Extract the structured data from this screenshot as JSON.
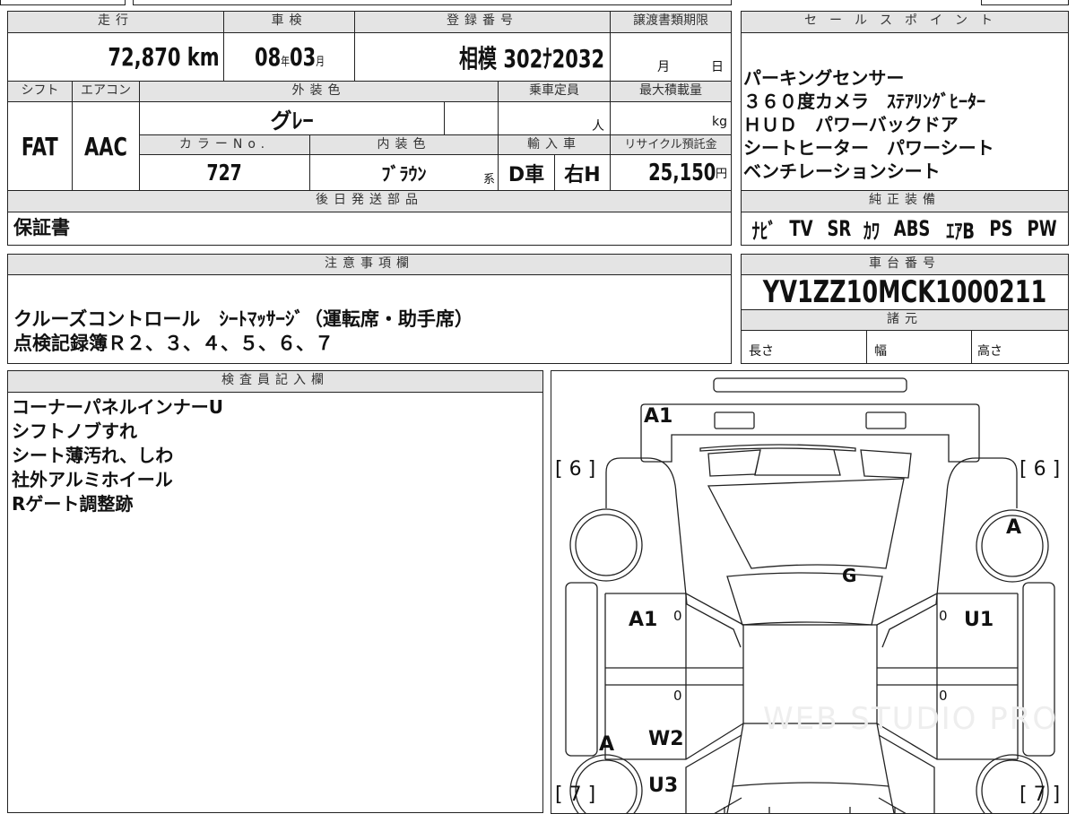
{
  "main": {
    "mileage_header": "走行",
    "mileage": "72,870",
    "mileage_unit": "km",
    "inspection_header": "車検",
    "inspection_year": "08",
    "year_unit": "年",
    "inspection_month": "03",
    "month_unit": "月",
    "registration_header": "登録番号",
    "registration": "相模 302ﾅ2032",
    "transfer_header": "譲渡書類期限",
    "transfer_month": "月",
    "transfer_day": "日",
    "shift_header": "シフト",
    "shift": "FAT",
    "ac_header": "エアコン",
    "ac": "AAC",
    "exterior_header": "外装色",
    "exterior": "グﾚｰ",
    "capacity_header": "乗車定員",
    "capacity_unit": "人",
    "load_header": "最大積載量",
    "load_unit": "kg",
    "color_no_header": "カラーNo.",
    "color_no": "727",
    "interior_header": "内装色",
    "interior": "ﾌﾞﾗｳﾝ",
    "interior_suffix": "系",
    "import_header": "輸入車",
    "import_type": "D車",
    "handle": "右H",
    "recycle_header": "リサイクル預託金",
    "recycle": "25,150",
    "recycle_unit": "円",
    "later_parts_header": "後日発送部品",
    "later_parts": "保証書"
  },
  "sales_points": {
    "header": "セールスポイント",
    "text": "パーキングセンサー\n３６０度カメラ　ｽﾃｱﾘﾝｸﾞﾋｰﾀｰ\nＨＵＤ　パワーバックドア\nシートヒーター　パワーシート\nベンチレーションシート"
  },
  "equipment": {
    "header": "純正装備",
    "items": [
      "ﾅﾋﾞ",
      "TV",
      "SR",
      "ｶﾜ",
      "ABS",
      "ｴｱB",
      "PS",
      "PW"
    ]
  },
  "notes": {
    "header": "注意事項欄",
    "text": "クルーズコントロール　ｼｰﾄﾏｯｻｰｼﾞ（運転席・助手席）\n点検記録簿Ｒ２、３、４、５、６、７"
  },
  "chassis": {
    "header": "車台番号",
    "vin": "YV1ZZ10MCK1000211",
    "spec_header": "諸元",
    "length": "長さ",
    "width": "幅",
    "height": "高さ"
  },
  "inspector": {
    "header": "検査員記入欄",
    "text": "コーナーパネルインナーU\nシフトノブすれ\nシート薄汚れ、しわ\n社外アルミホイール\nRゲート調整跡"
  },
  "diagram": {
    "front_bumper": "A1",
    "front_left_count": "[ 6 ]",
    "front_right_count": "[ 6 ]",
    "front_right_wheel": "A",
    "windshield": "G",
    "left_front_door": "A1",
    "right_front_door": "U1",
    "zero": "0",
    "left_rear_wheel": "A",
    "left_rear_fender_1": "W2",
    "left_rear_fender_2": "U3",
    "rear_left_count": "[ 7 ]",
    "rear_right_count": "[ 7 ]",
    "watermark": "WEB STUDIO PRO"
  }
}
